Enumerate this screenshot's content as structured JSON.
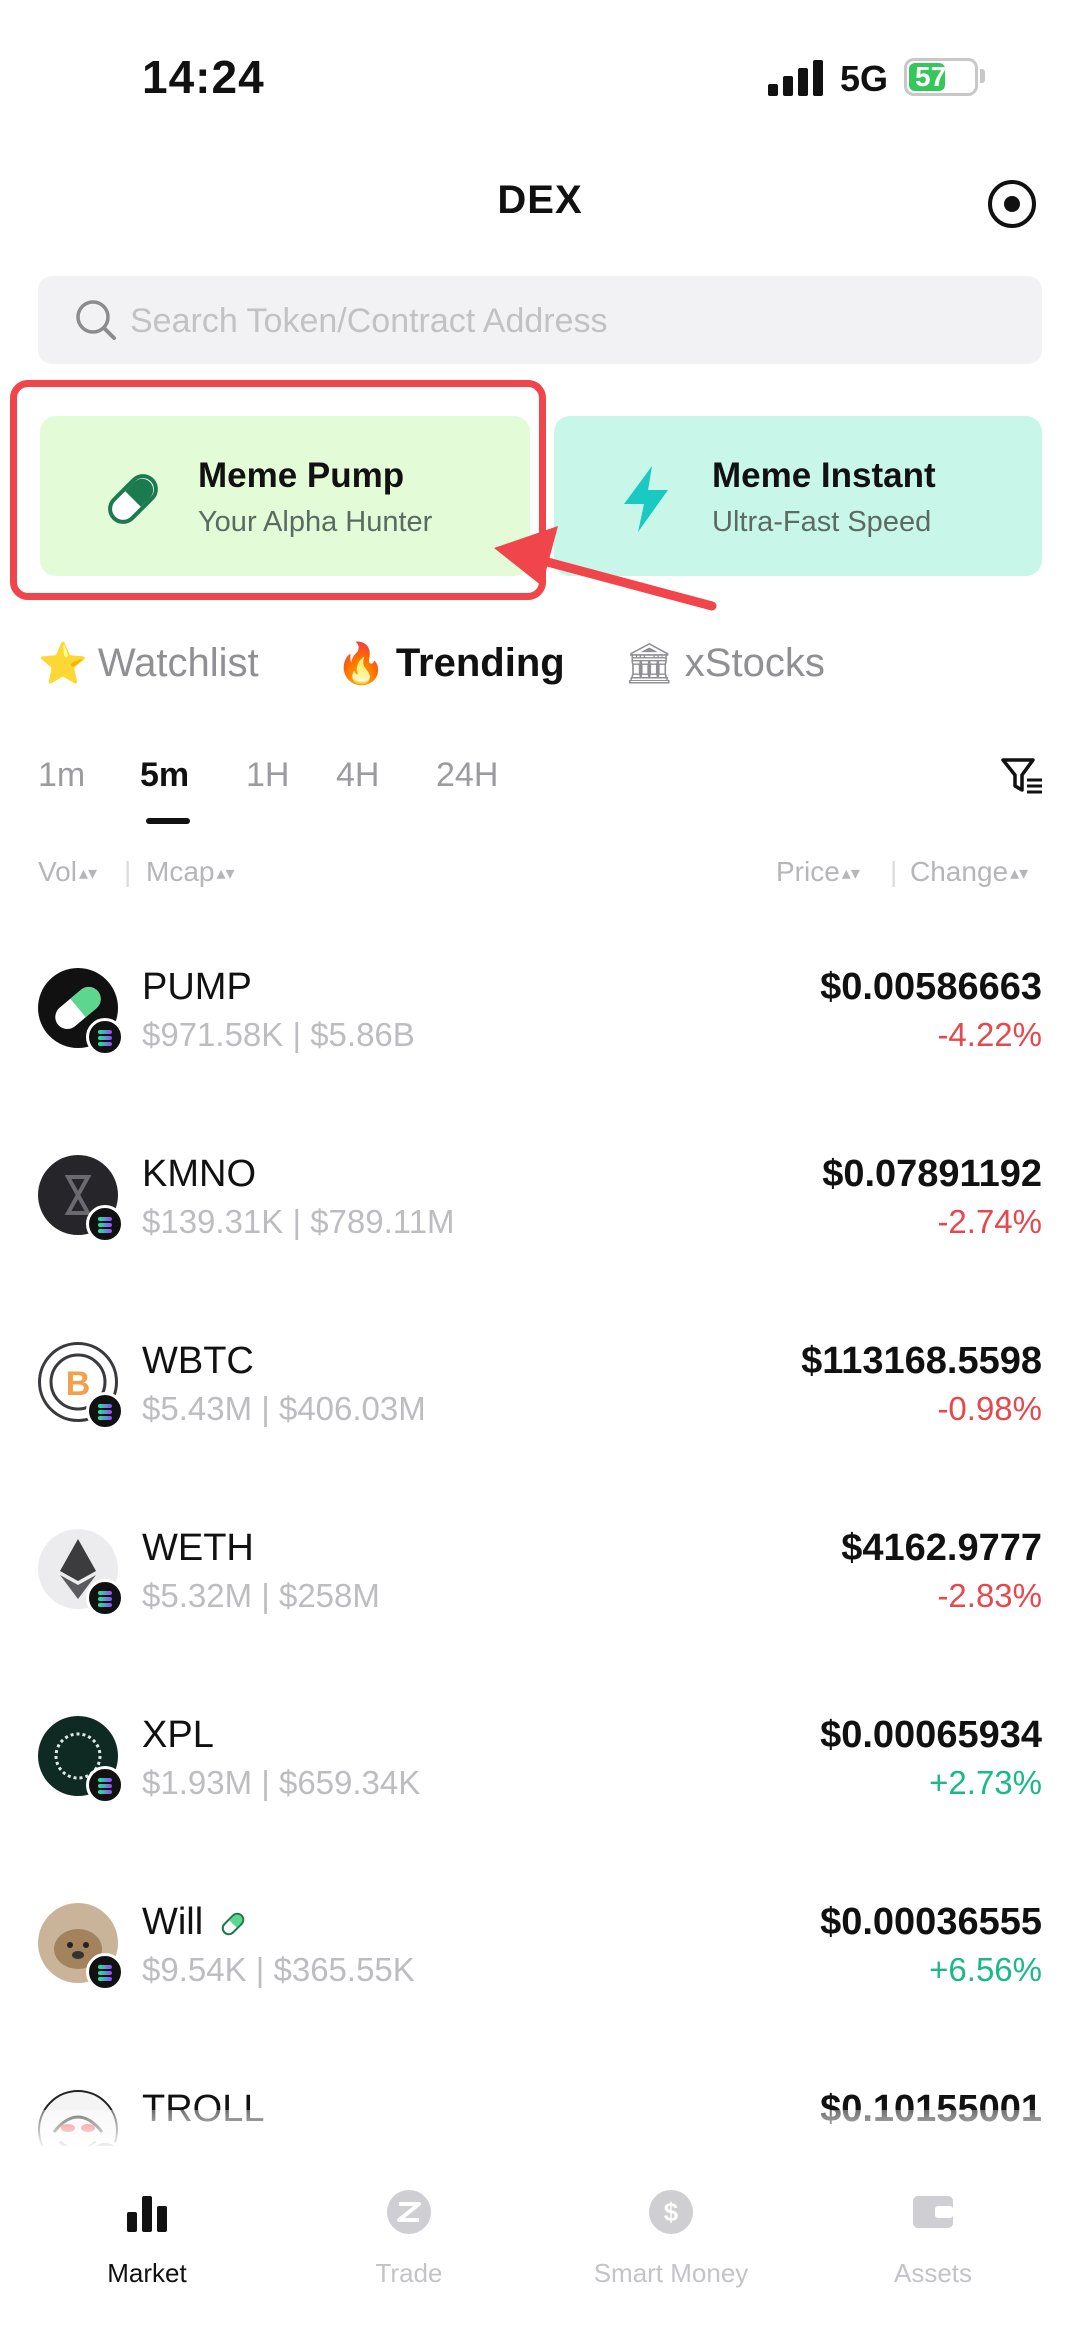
{
  "status_bar": {
    "time": "14:24",
    "network": "5G",
    "battery": "57",
    "battery_level": 0.57
  },
  "header": {
    "title": "DEX"
  },
  "search": {
    "placeholder": "Search Token/Contract Address"
  },
  "meme_cards": [
    {
      "title": "Meme Pump",
      "subtitle": "Your Alpha Hunter",
      "icon": "pill-icon"
    },
    {
      "title": "Meme Instant",
      "subtitle": "Ultra-Fast Speed",
      "icon": "lightning-icon"
    }
  ],
  "categories": [
    {
      "emoji": "⭐",
      "label": "Watchlist",
      "active": false
    },
    {
      "emoji": "🔥",
      "label": "Trending",
      "active": true
    },
    {
      "emoji": "🏛",
      "label": "xStocks",
      "active": false
    }
  ],
  "time_tabs": [
    "1m",
    "5m",
    "1H",
    "4H",
    "24H"
  ],
  "active_time_tab": "5m",
  "columns": {
    "vol": "Vol",
    "mcap": "Mcap",
    "price": "Price",
    "change": "Change"
  },
  "tokens": [
    {
      "name": "PUMP",
      "stats": "$971.58K | $5.86B",
      "price": "$0.00586663",
      "change": "-4.22%",
      "direction": "down"
    },
    {
      "name": "KMNO",
      "stats": "$139.31K | $789.11M",
      "price": "$0.07891192",
      "change": "-2.74%",
      "direction": "down"
    },
    {
      "name": "WBTC",
      "stats": "$5.43M | $406.03M",
      "price": "$113168.5598",
      "change": "-0.98%",
      "direction": "down"
    },
    {
      "name": "WETH",
      "stats": "$5.32M | $258M",
      "price": "$4162.9777",
      "change": "-2.83%",
      "direction": "down"
    },
    {
      "name": "XPL",
      "stats": "$1.93M | $659.34K",
      "price": "$0.00065934",
      "change": "+2.73%",
      "direction": "up"
    },
    {
      "name": "Will",
      "stats": "$9.54K | $365.55K",
      "price": "$0.00036555",
      "change": "+6.56%",
      "direction": "up"
    },
    {
      "name": "TROLL",
      "stats": "",
      "price": "$0.10155001",
      "change": "",
      "direction": "down"
    }
  ],
  "bottom_nav": [
    {
      "label": "Market",
      "icon": "bar-chart-icon",
      "active": true
    },
    {
      "label": "Trade",
      "icon": "trade-icon",
      "active": false
    },
    {
      "label": "Smart Money",
      "icon": "dollar-icon",
      "active": false
    },
    {
      "label": "Assets",
      "icon": "wallet-icon",
      "active": false
    }
  ],
  "colors": {
    "negative": "#e5484d",
    "positive": "#1bb98a",
    "highlight": "#f0454a",
    "pump_card": "#e3fbd6",
    "instant_card": "#c8f7ea"
  }
}
